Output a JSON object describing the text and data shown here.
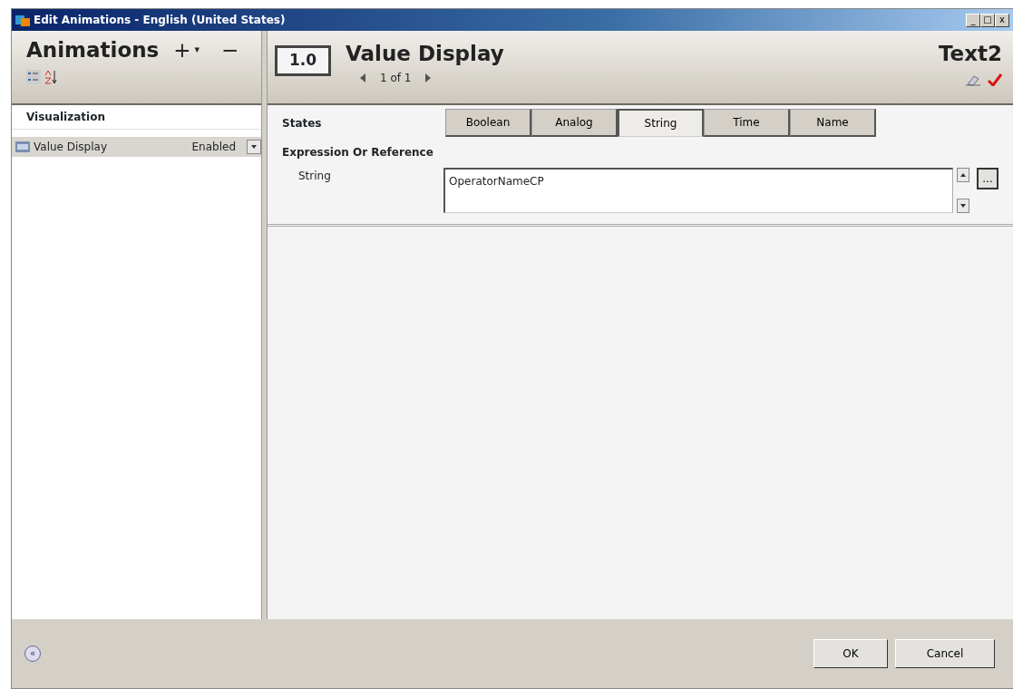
{
  "window": {
    "title": "Edit Animations - English (United States)",
    "controls": [
      "_",
      "□",
      "x"
    ]
  },
  "sidebar": {
    "title": "Animations",
    "add": "+",
    "add_caret": "▾",
    "remove": "−",
    "group": "Visualization",
    "items": [
      {
        "name": "Value Display",
        "status": "Enabled",
        "selected": true
      }
    ]
  },
  "header": {
    "icon_text": "1.0",
    "title": "Value Display",
    "pager": "1 of 1",
    "object": "Text2"
  },
  "states": {
    "label": "States",
    "tabs": [
      {
        "label": "Boolean",
        "selected": false
      },
      {
        "label": "Analog",
        "selected": false
      },
      {
        "label": "String",
        "selected": true
      },
      {
        "label": "Time",
        "selected": false
      },
      {
        "label": "Name",
        "selected": false
      }
    ]
  },
  "expression": {
    "label": "Expression Or Reference",
    "field_label": "String",
    "value": "OperatorNameCP",
    "browse": "..."
  },
  "footer": {
    "collapse": "«",
    "buttons": [
      "OK",
      "Cancel"
    ]
  }
}
